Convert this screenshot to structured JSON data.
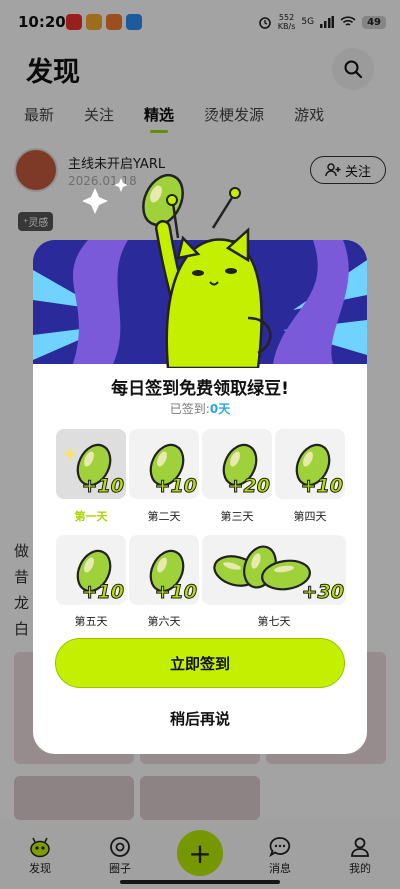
{
  "status": {
    "time": "10:20",
    "net_speed": "552",
    "net_unit": "KB/s",
    "signal": "5G",
    "battery": "49"
  },
  "header": {
    "title": "发现"
  },
  "tabs": [
    "最新",
    "关注",
    "精选",
    "烫梗发源",
    "游戏"
  ],
  "active_tab": "精选",
  "post": {
    "author": "主线未开启YARL",
    "date": "2026.01.18",
    "follow_label": "关注",
    "tag": "灵感"
  },
  "side_text": [
    "做",
    "昔",
    "龙",
    "白"
  ],
  "modal": {
    "title": "每日签到免费领取绿豆!",
    "signed_prefix": "已签到:",
    "signed_count": "0天",
    "days": [
      {
        "label": "第一天",
        "bonus": "+10",
        "today": true
      },
      {
        "label": "第二天",
        "bonus": "+10"
      },
      {
        "label": "第三天",
        "bonus": "+20"
      },
      {
        "label": "第四天",
        "bonus": "+10"
      },
      {
        "label": "第五天",
        "bonus": "+10"
      },
      {
        "label": "第六天",
        "bonus": "+10"
      },
      {
        "label": "第七天",
        "bonus": "+30"
      }
    ],
    "sign_button": "立即签到",
    "later_button": "稍后再说"
  },
  "bottom_nav": [
    {
      "label": "发现",
      "icon": "discover-icon"
    },
    {
      "label": "圈子",
      "icon": "circle-icon"
    },
    {
      "label": "",
      "icon": "plus-icon"
    },
    {
      "label": "消息",
      "icon": "message-icon"
    },
    {
      "label": "我的",
      "icon": "profile-icon"
    }
  ],
  "colors": {
    "accent": "#c4f000",
    "bean": "#9fd23a",
    "banner": "#2b2a9a",
    "signed_count": "#24a9e8"
  }
}
